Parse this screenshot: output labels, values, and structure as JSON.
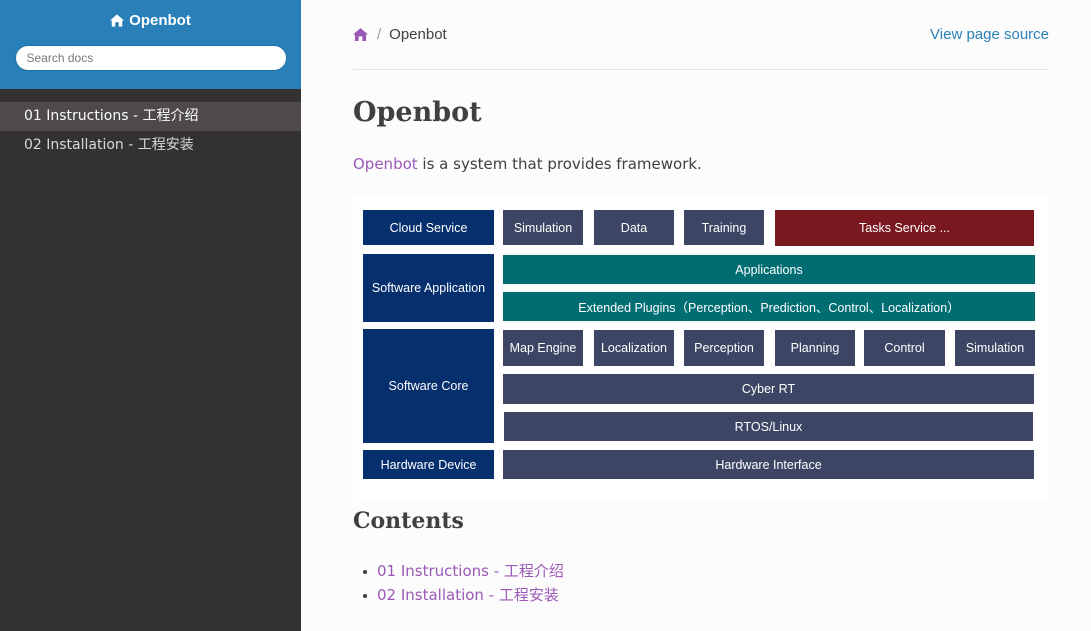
{
  "sidebar": {
    "brand": "Openbot",
    "search_placeholder": "Search docs",
    "items": [
      {
        "label": "01 Instructions - 工程介绍"
      },
      {
        "label": "02 Installation - 工程安装"
      }
    ]
  },
  "breadcrumb": {
    "current": "Openbot",
    "separator": "/",
    "view_source": "View page source"
  },
  "page": {
    "title": "Openbot",
    "intro_link": "Openbot",
    "intro_rest": " is a system that provides framework."
  },
  "diagram": {
    "layers": {
      "cloud": "Cloud Service",
      "software_app": "Software Application",
      "software_core": "Software Core",
      "hardware": "Hardware Device"
    },
    "cloud_items": [
      "Simulation",
      "Data",
      "Training",
      "Tasks Service ..."
    ],
    "applications": "Applications",
    "plugins": "Extended Plugins（Perception、Prediction、Control、Localization）",
    "core_modules": [
      "Map Engine",
      "Localization",
      "Perception",
      "Planning",
      "Control",
      "Simulation"
    ],
    "cyber_rt": "Cyber RT",
    "rtos": "RTOS/Linux",
    "hardware_interface": "Hardware Interface"
  },
  "contents": {
    "heading": "Contents",
    "items": [
      "01 Instructions - 工程介绍",
      "02 Installation - 工程安装"
    ]
  },
  "colors": {
    "sidebar_bg": "#343131",
    "header_bg": "#2980b9",
    "link_purple": "#9b59b6",
    "link_blue": "#2980b9",
    "layer_blue": "#052f6d",
    "module_gray": "#3c4563",
    "teal": "#006d73",
    "red": "#79191f"
  }
}
